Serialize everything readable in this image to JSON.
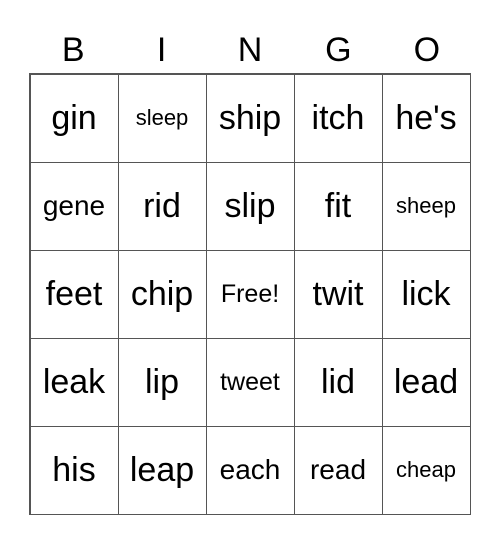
{
  "header": [
    "B",
    "I",
    "N",
    "G",
    "O"
  ],
  "cells": [
    [
      "gin",
      "sleep",
      "ship",
      "itch",
      "he's"
    ],
    [
      "gene",
      "rid",
      "slip",
      "fit",
      "sheep"
    ],
    [
      "feet",
      "chip",
      "Free!",
      "twit",
      "lick"
    ],
    [
      "leak",
      "lip",
      "tweet",
      "lid",
      "lead"
    ],
    [
      "his",
      "leap",
      "each",
      "read",
      "cheap"
    ]
  ]
}
